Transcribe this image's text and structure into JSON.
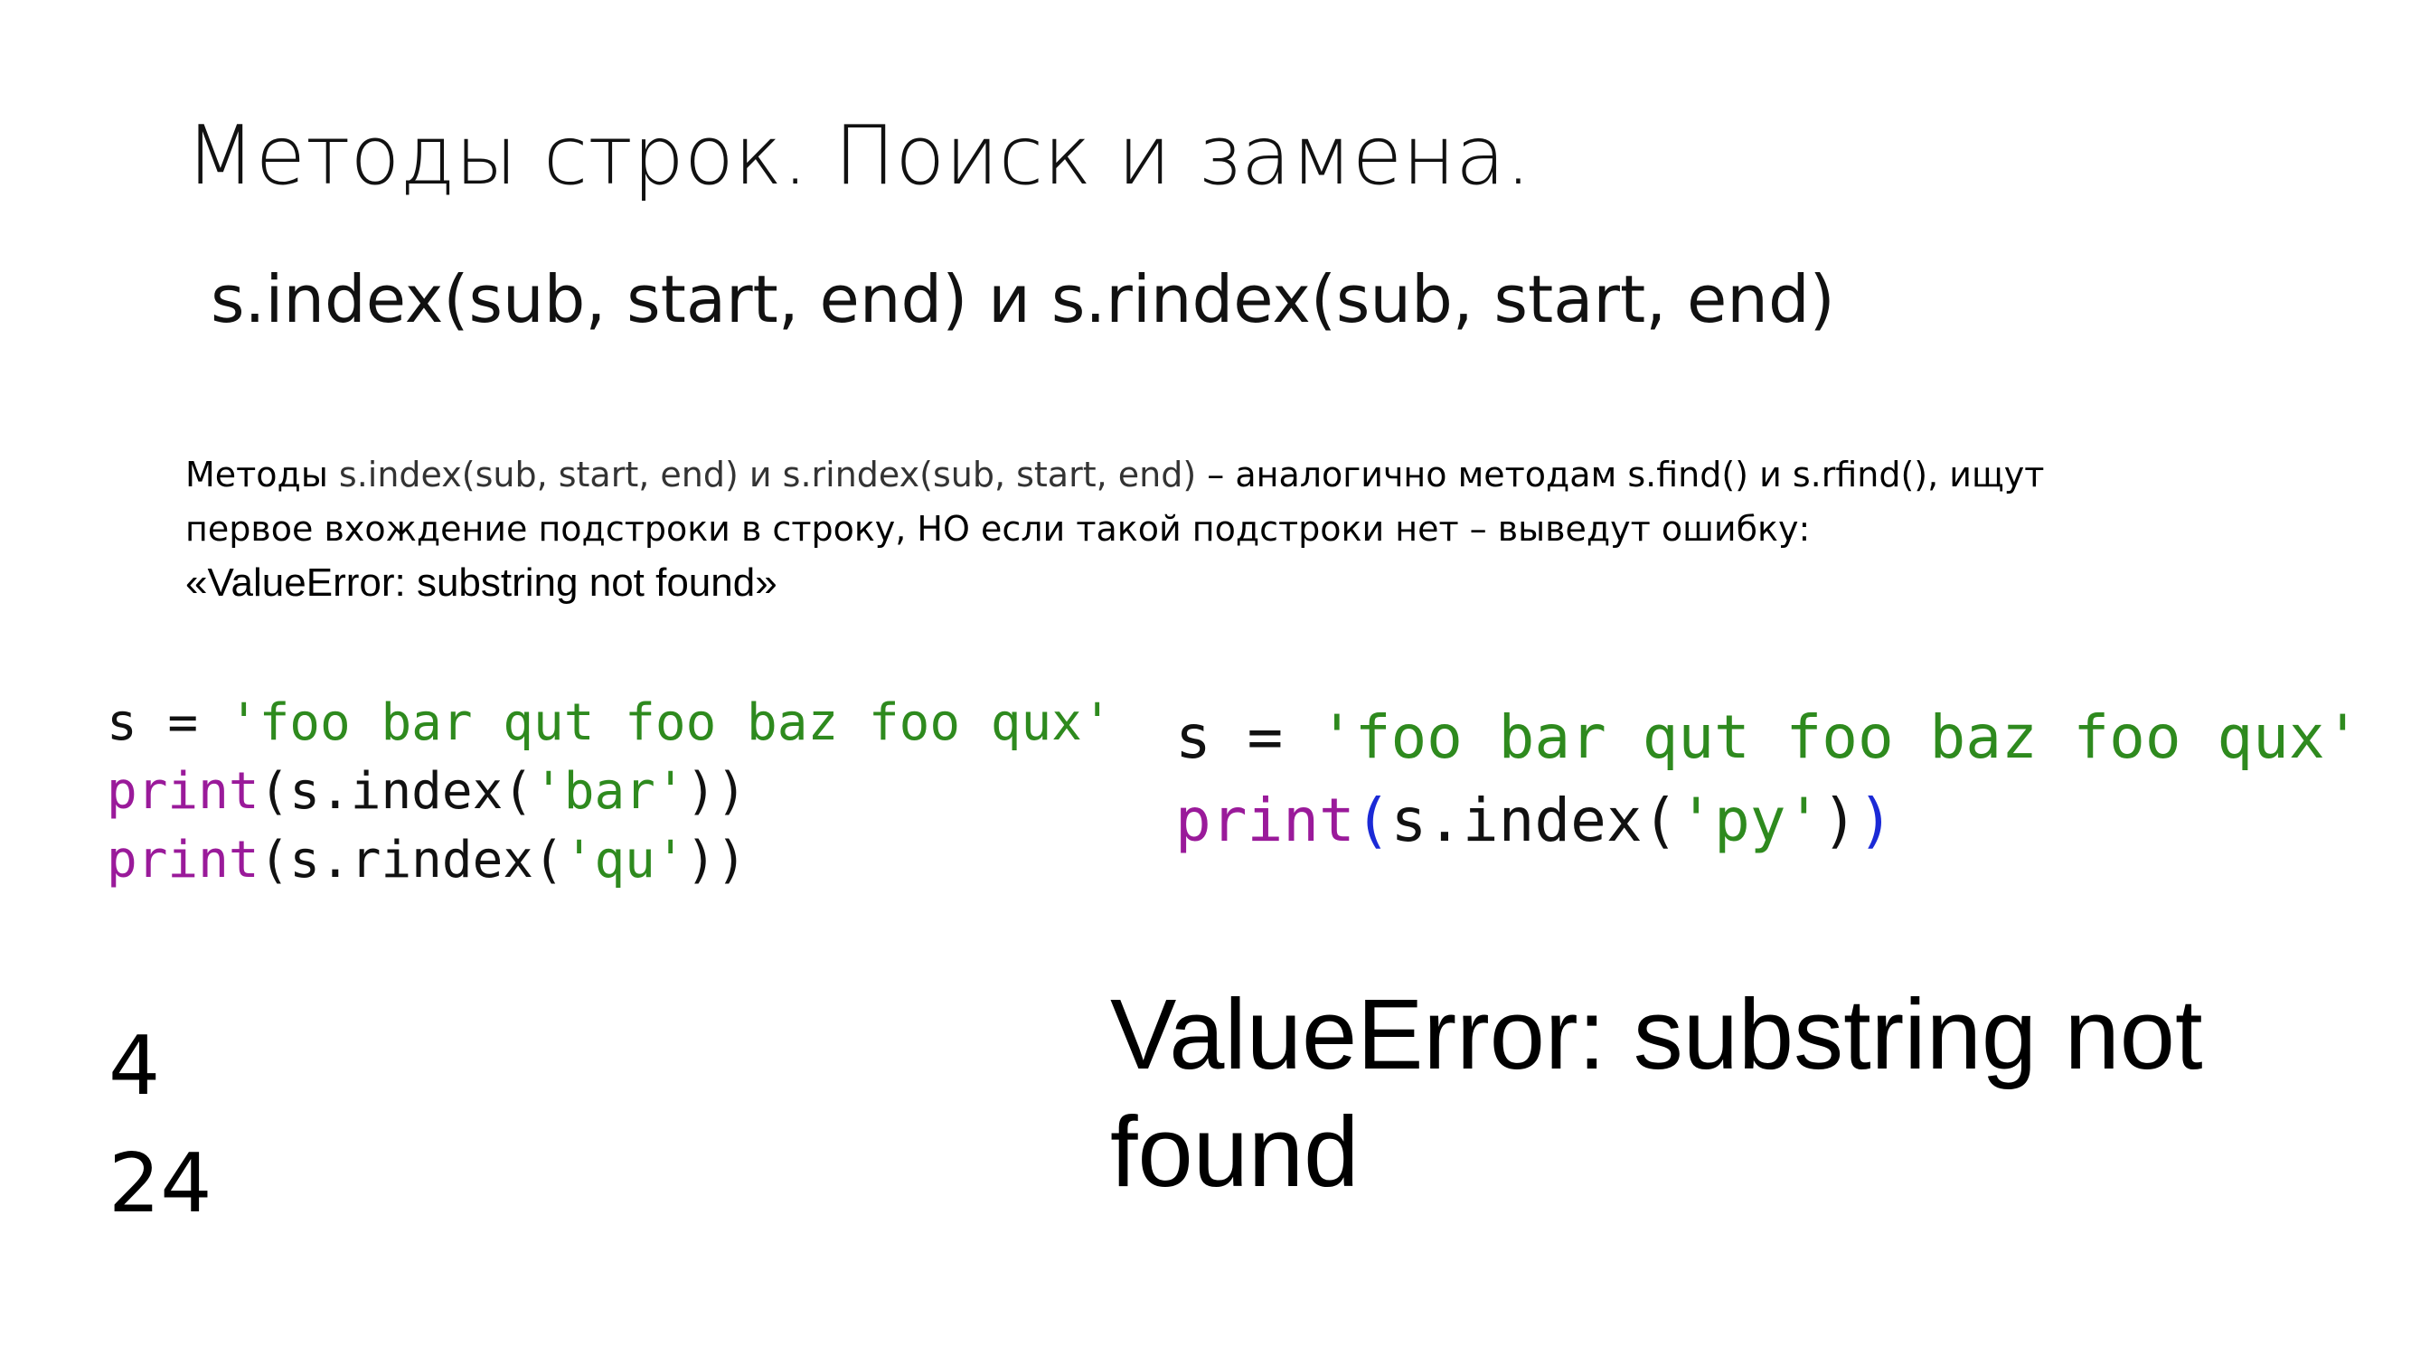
{
  "slide": {
    "title": "Методы строк. Поиск и замена.",
    "subtitle": "s.index(sub, start, end) и s.rindex(sub, start, end)"
  },
  "description": {
    "prefix": "Методы ",
    "methods": "s.index(sub, start, end) и s.rindex(sub, start, end)",
    "rest_line1": " – аналогично методам s.find() и s.rfind(), ищут",
    "line2": "первое вхождение подстроки в строку, НО если такой подстроки нет – выведут ошибку:",
    "line3": "«ValueError: substring not found»"
  },
  "code_left": {
    "line1": {
      "var": "s",
      "op": " = ",
      "str": "'foo bar qut foo baz foo qux'"
    },
    "line2": {
      "fn": "print",
      "open": "(",
      "call": "s.index(",
      "str": "'bar'",
      "close": "))"
    },
    "line3": {
      "fn": "print",
      "open": "(",
      "call": "s.rindex(",
      "str": "'qu'",
      "close": "))"
    }
  },
  "code_right": {
    "line1": {
      "var": "s",
      "op": " = ",
      "str": "'foo bar qut foo baz foo qux'"
    },
    "line2": {
      "fn": "print",
      "open": "(",
      "call": "s.index(",
      "str": "'py'",
      "close1": ")",
      "close2": ")"
    }
  },
  "output_left": [
    "4",
    "24"
  ],
  "output_right": "ValueError: substring not found"
}
